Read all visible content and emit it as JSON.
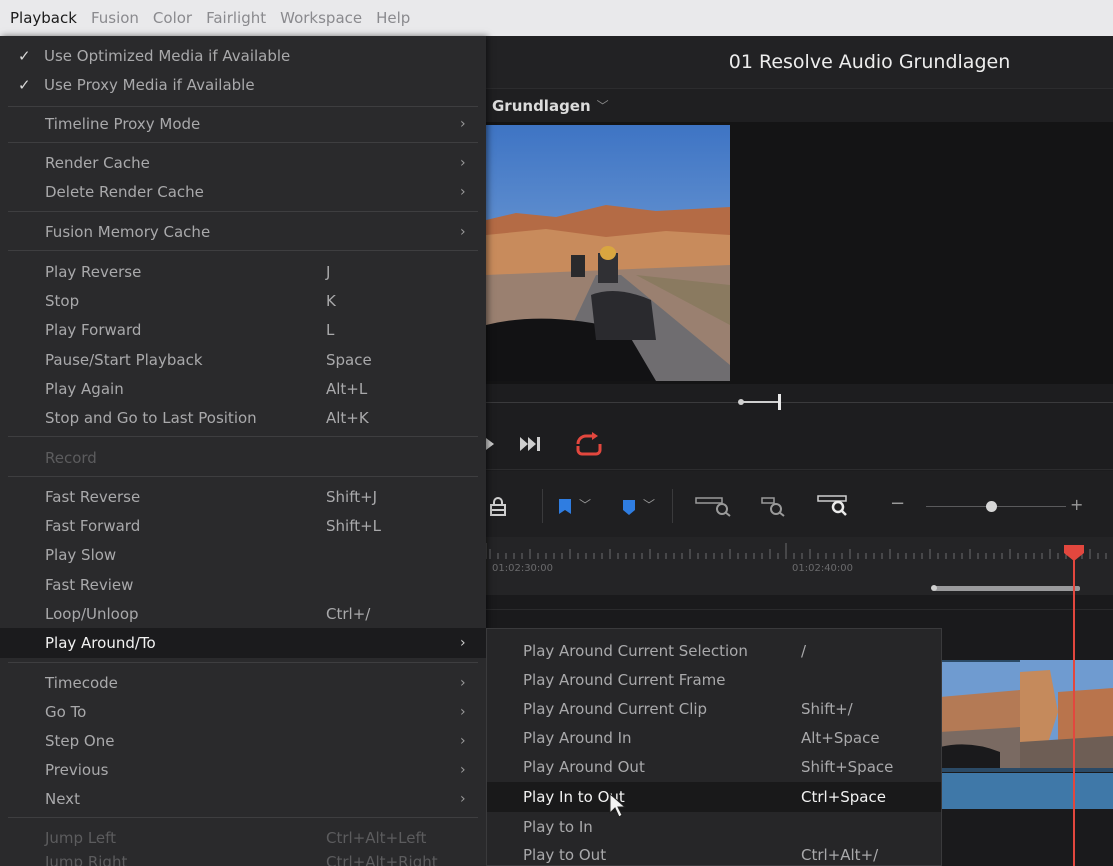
{
  "menubar": {
    "items": [
      "Playback",
      "Fusion",
      "Color",
      "Fairlight",
      "Workspace",
      "Help"
    ]
  },
  "project": {
    "title": "01 Resolve Audio Grundlagen",
    "viewer_timeline": "Grundlagen"
  },
  "timeline": {
    "timecodes": [
      "01:02:30:00",
      "01:02:40:00"
    ]
  },
  "playback_menu": {
    "items": [
      {
        "label": "Use Optimized Media if Available",
        "checked": true
      },
      {
        "label": "Use Proxy Media if Available",
        "checked": true
      },
      {
        "label": "Timeline Proxy Mode",
        "submenu": true
      },
      {
        "label": "Render Cache",
        "submenu": true
      },
      {
        "label": "Delete Render Cache",
        "submenu": true
      },
      {
        "label": "Fusion Memory Cache",
        "submenu": true
      },
      {
        "label": "Play Reverse",
        "shortcut": "J"
      },
      {
        "label": "Stop",
        "shortcut": "K"
      },
      {
        "label": "Play Forward",
        "shortcut": "L"
      },
      {
        "label": "Pause/Start Playback",
        "shortcut": "Space"
      },
      {
        "label": "Play Again",
        "shortcut": "Alt+L"
      },
      {
        "label": "Stop and Go to Last Position",
        "shortcut": "Alt+K"
      },
      {
        "label": "Record",
        "disabled": true
      },
      {
        "label": "Fast Reverse",
        "shortcut": "Shift+J"
      },
      {
        "label": "Fast Forward",
        "shortcut": "Shift+L"
      },
      {
        "label": "Play Slow"
      },
      {
        "label": "Fast Review"
      },
      {
        "label": "Loop/Unloop",
        "shortcut": "Ctrl+/"
      },
      {
        "label": "Play Around/To",
        "submenu": true,
        "highlighted": true
      },
      {
        "label": "Timecode",
        "submenu": true
      },
      {
        "label": "Go To",
        "submenu": true
      },
      {
        "label": "Step One",
        "submenu": true
      },
      {
        "label": "Previous",
        "submenu": true
      },
      {
        "label": "Next",
        "submenu": true
      },
      {
        "label": "Jump Left",
        "shortcut": "Ctrl+Alt+Left",
        "disabled": true
      },
      {
        "label": "Jump Right",
        "shortcut": "Ctrl+Alt+Right",
        "disabled": true
      }
    ]
  },
  "play_around_submenu": {
    "items": [
      {
        "label": "Play Around Current Selection",
        "shortcut": "/"
      },
      {
        "label": "Play Around Current Frame"
      },
      {
        "label": "Play Around Current Clip",
        "shortcut": "Shift+/"
      },
      {
        "label": "Play Around In",
        "shortcut": "Alt+Space"
      },
      {
        "label": "Play Around Out",
        "shortcut": "Shift+Space"
      },
      {
        "label": "Play In to Out",
        "shortcut": "Ctrl+Space",
        "highlighted": true
      },
      {
        "label": "Play to In"
      },
      {
        "label": "Play to Out",
        "shortcut": "Ctrl+Alt+/"
      }
    ]
  },
  "icons": [
    "checkmark-icon",
    "chevron-right-icon",
    "skip-forward-icon",
    "loop-icon",
    "lock-icon",
    "flag-marker-icon",
    "marker-icon",
    "zoom-icon",
    "mouse-cursor-icon"
  ],
  "colors": {
    "playhead": "#e2473e",
    "loop_accent": "#e2473e",
    "marker_blue": "#2f7de1",
    "clip_blue": "#3f78a8"
  }
}
